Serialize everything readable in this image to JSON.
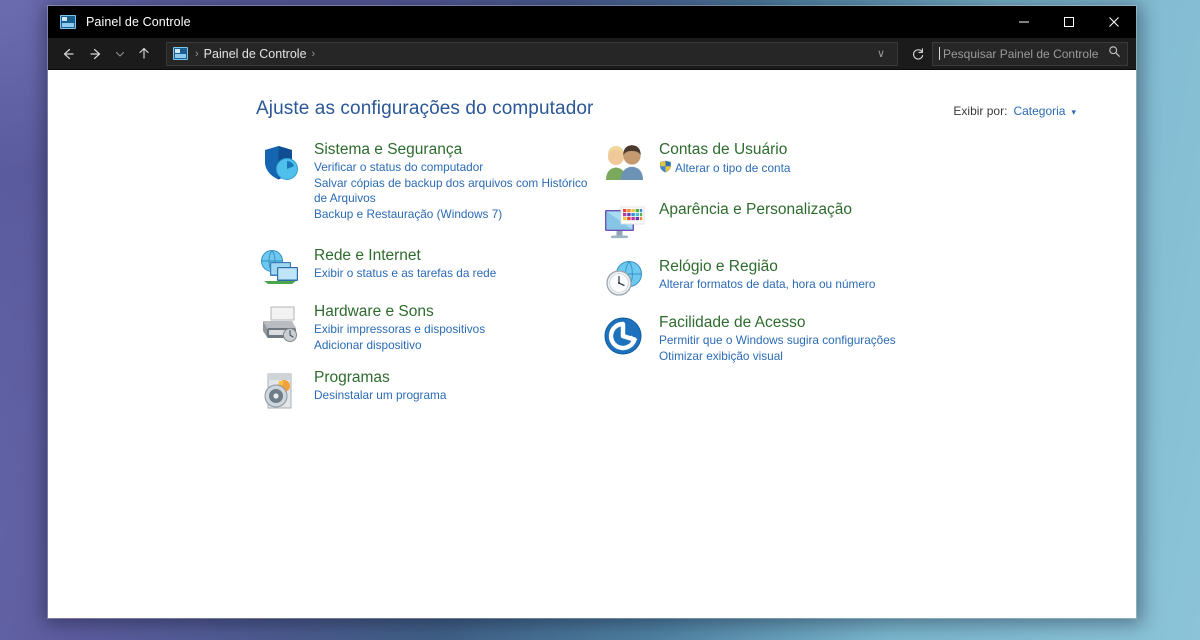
{
  "window": {
    "title": "Painel de Controle",
    "title_icon": "control-panel-icon",
    "controls": {
      "minimize": "–",
      "maximize": "□",
      "close": "✕"
    }
  },
  "navbar": {
    "back": "back-arrow-icon",
    "forward": "forward-arrow-icon",
    "recent": "chevron-down-icon",
    "up": "up-arrow-icon",
    "breadcrumb": {
      "icon": "control-panel-icon",
      "separator": "›",
      "text": "Painel de Controle",
      "trailing_separator": "›"
    },
    "refresh": "refresh-icon",
    "address_caret": "∨"
  },
  "search": {
    "placeholder": "Pesquisar Painel de Controle",
    "value": "",
    "icon": "search-icon"
  },
  "main": {
    "page_title": "Ajuste as configurações do computador",
    "view_by": {
      "label": "Exibir por:",
      "value": "Categoria",
      "caret": "▾"
    },
    "columns": [
      {
        "categories": [
          {
            "id": "sistema-e-seguranca",
            "icon": "shield-clock-icon",
            "title": "Sistema e Segurança",
            "links": [
              {
                "text": "Verificar o status do computador",
                "shield": false
              },
              {
                "text": "Salvar cópias de backup dos arquivos com Histórico de Arquivos",
                "shield": false
              },
              {
                "text": "Backup e Restauração (Windows 7)",
                "shield": false
              }
            ]
          },
          {
            "id": "rede-e-internet",
            "icon": "network-globe-icon",
            "title": "Rede e Internet",
            "links": [
              {
                "text": "Exibir o status e as tarefas da rede",
                "shield": false
              }
            ]
          },
          {
            "id": "hardware-e-sons",
            "icon": "printer-icon",
            "title": "Hardware e Sons",
            "links": [
              {
                "text": "Exibir impressoras e dispositivos",
                "shield": false
              },
              {
                "text": "Adicionar dispositivo",
                "shield": false
              }
            ]
          },
          {
            "id": "programas",
            "icon": "programs-disc-icon",
            "title": "Programas",
            "links": [
              {
                "text": "Desinstalar um programa",
                "shield": false
              }
            ]
          }
        ]
      },
      {
        "categories": [
          {
            "id": "contas-de-usuario",
            "icon": "user-accounts-icon",
            "title": "Contas de Usuário",
            "links": [
              {
                "text": "Alterar o tipo de conta",
                "shield": true
              }
            ]
          },
          {
            "id": "aparencia-e-personalizacao",
            "icon": "appearance-monitor-icon",
            "title": "Aparência e Personalização",
            "links": []
          },
          {
            "id": "relogio-e-regiao",
            "icon": "clock-globe-icon",
            "title": "Relógio e Região",
            "links": [
              {
                "text": "Alterar formatos de data, hora ou número",
                "shield": false
              }
            ]
          },
          {
            "id": "facilidade-de-acesso",
            "icon": "accessibility-icon",
            "title": "Facilidade de Acesso",
            "links": [
              {
                "text": "Permitir que o Windows sugira configurações",
                "shield": false
              },
              {
                "text": "Otimizar exibição visual",
                "shield": false
              }
            ]
          }
        ]
      }
    ]
  },
  "colors": {
    "title_blue": "#2b5797",
    "category_green": "#2e6b2e",
    "link_blue": "#2b6bb5",
    "titlebar_bg": "#000000",
    "navbar_bg": "#1b1b1b",
    "desktop_gradient_start": "#6666ab",
    "desktop_gradient_end": "#8cc3d8"
  }
}
